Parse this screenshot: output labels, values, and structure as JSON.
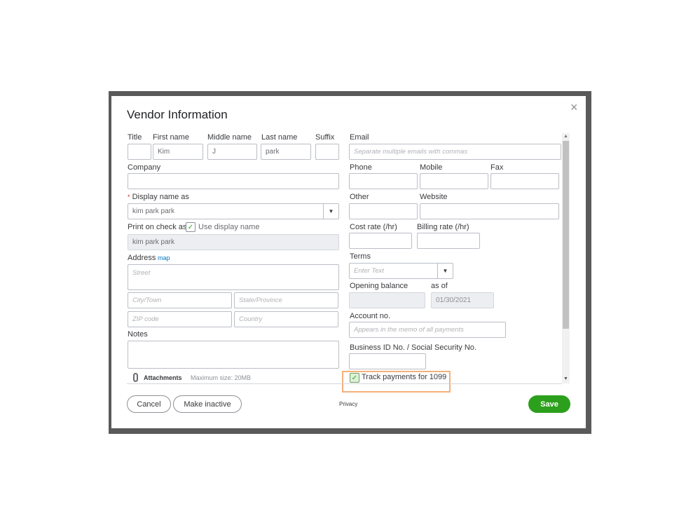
{
  "dialog": {
    "title": "Vendor Information",
    "close_icon": "close-icon"
  },
  "name": {
    "title_label": "Title",
    "first_label": "First name",
    "first_value": "Kim",
    "middle_label": "Middle name",
    "middle_value": "J",
    "last_label": "Last name",
    "last_value": "park",
    "suffix_label": "Suffix"
  },
  "company_label": "Company",
  "display": {
    "required_mark": "*",
    "label": "Display name as",
    "value": "kim park park"
  },
  "print_check": {
    "label": "Print on check as",
    "checkbox_label": "Use display name",
    "checked": true,
    "value": "kim park park"
  },
  "address": {
    "label": "Address",
    "map_link": "map",
    "street_ph": "Street",
    "city_ph": "City/Town",
    "state_ph": "State/Province",
    "zip_ph": "ZIP code",
    "country_ph": "Country"
  },
  "notes_label": "Notes",
  "attachments": {
    "label": "Attachments",
    "max_size": "Maximum size: 20MB"
  },
  "email": {
    "label": "Email",
    "placeholder": "Separate multiple emails with commas"
  },
  "phone_label": "Phone",
  "mobile_label": "Mobile",
  "fax_label": "Fax",
  "other_label": "Other",
  "website_label": "Website",
  "cost_rate_label": "Cost rate (/hr)",
  "billing_rate_label": "Billing rate (/hr)",
  "terms": {
    "label": "Terms",
    "placeholder": "Enter Text"
  },
  "opening_balance": {
    "label": "Opening balance",
    "as_of_label": "as of",
    "as_of_value": "01/30/2021"
  },
  "account": {
    "label": "Account no.",
    "placeholder": "Appears in the memo of all payments"
  },
  "business_id_label": "Business ID No. / Social Security No.",
  "track_1099": {
    "label": "Track payments for 1099",
    "checked": true,
    "highlight_color": "#f5b07a"
  },
  "footer": {
    "cancel": "Cancel",
    "make_inactive": "Make inactive",
    "privacy": "Privacy",
    "save": "Save"
  },
  "colors": {
    "accent": "#2ca01c",
    "link": "#0077c5",
    "required": "#d52b1e"
  }
}
